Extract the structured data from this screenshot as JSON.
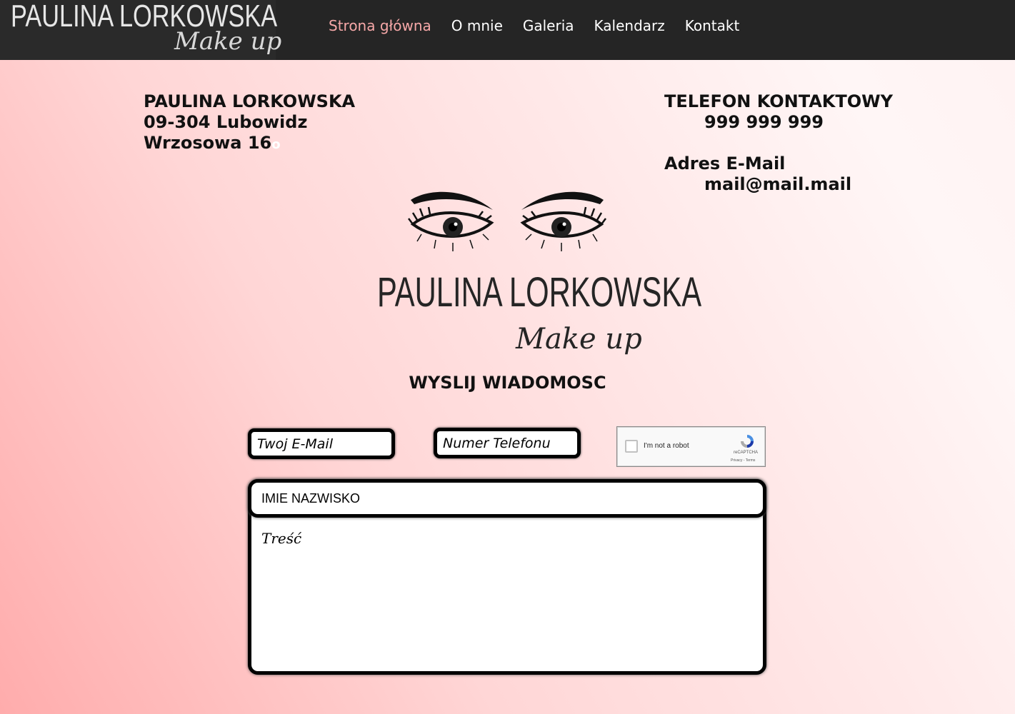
{
  "header": {
    "logo_name": "PAULINA LORKOWSKA",
    "logo_script": "Make up",
    "nav": [
      {
        "label": "Strona główna",
        "active": true
      },
      {
        "label": "O mnie"
      },
      {
        "label": "Galeria"
      },
      {
        "label": "Kalendarz"
      },
      {
        "label": "Kontakt"
      }
    ]
  },
  "address": {
    "name": "PAULINA LORKOWSKA",
    "city": "09-304 Lubowidz",
    "street": "Wrzosowa 16",
    "street_suffix": "o"
  },
  "contact": {
    "phone_label": "TELEFON KONTAKTOWY",
    "phone": "999 999 999",
    "email_label": "Adres E-Mail",
    "email": "mail@mail.mail"
  },
  "brand": {
    "name": "PAULINA LORKOWSKA",
    "script": "Make up"
  },
  "form": {
    "title": "WYSLIJ WIADOMOSC",
    "email_placeholder": "Twoj E-Mail",
    "phone_placeholder": "Numer Telefonu",
    "captcha_label": "I'm not a robot",
    "captcha_brand": "reCAPTCHA",
    "captcha_links": "Privacy - Terms",
    "name_placeholder": "IMIE NAZWISKO",
    "body_placeholder": "Treść"
  },
  "colors": {
    "topbar": "#252525",
    "nav_active": "#f6a8a8",
    "nav_text": "#ffffff"
  }
}
